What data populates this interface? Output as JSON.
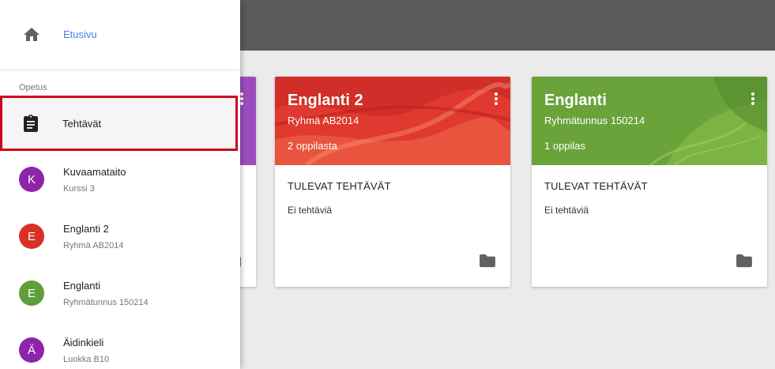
{
  "drawer": {
    "home_label": "Etusivu",
    "section_label": "Opetus",
    "todo_label": "Tehtävät",
    "classes": [
      {
        "initial": "K",
        "title": "Kuvaamataito",
        "subtitle": "Kurssi 3",
        "color": "#8e24aa"
      },
      {
        "initial": "E",
        "title": "Englanti 2",
        "subtitle": "Ryhmä AB2014",
        "color": "#d93025"
      },
      {
        "initial": "E",
        "title": "Englanti",
        "subtitle": "Ryhmätunnus 150214",
        "color": "#5f9f3a"
      },
      {
        "initial": "Ä",
        "title": "Äidinkieli",
        "subtitle": "Luokka B10",
        "color": "#8e24aa"
      }
    ]
  },
  "cards": [
    {
      "title": "Englanti 2",
      "section": "Ryhmä AB2014",
      "count": "2 oppilasta",
      "upcoming": "TULEVAT TEHTÄVÄT",
      "empty": "Ei tehtäviä",
      "color": "#e53935"
    },
    {
      "title": "Englanti",
      "section": "Ryhmätunnus 150214",
      "count": "1 oppilas",
      "upcoming": "TULEVAT TEHTÄVÄT",
      "empty": "Ei tehtäviä",
      "color": "#6aa33a"
    }
  ],
  "colors": {
    "appbar": "#5a5a5a",
    "link": "#4285f4",
    "highlight_border": "#d0021b"
  }
}
